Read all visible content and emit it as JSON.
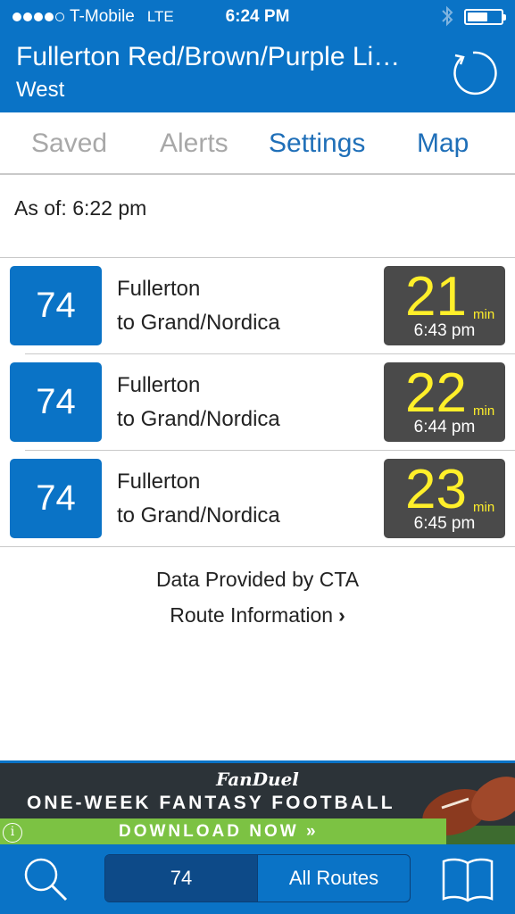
{
  "status_bar": {
    "carrier": "T-Mobile",
    "network": "LTE",
    "time": "6:24 PM"
  },
  "header": {
    "title": "Fullerton Red/Brown/Purple Li…",
    "subtitle": "West"
  },
  "tabs": [
    {
      "label": "Saved",
      "active": false
    },
    {
      "label": "Alerts",
      "active": false
    },
    {
      "label": "Settings",
      "active": true
    },
    {
      "label": "Map",
      "active": true
    }
  ],
  "as_of": "As of: 6:22 pm",
  "predictions": [
    {
      "route": "74",
      "stop": "Fullerton",
      "destination": "to Grand/Nordica",
      "minutes": "21",
      "unit": "min",
      "arrival": "6:43 pm"
    },
    {
      "route": "74",
      "stop": "Fullerton",
      "destination": "to Grand/Nordica",
      "minutes": "22",
      "unit": "min",
      "arrival": "6:44 pm"
    },
    {
      "route": "74",
      "stop": "Fullerton",
      "destination": "to Grand/Nordica",
      "minutes": "23",
      "unit": "min",
      "arrival": "6:45 pm"
    }
  ],
  "footer": {
    "credit": "Data Provided by CTA",
    "route_info": "Route Information"
  },
  "ad": {
    "brand": "FanDuel",
    "headline": "ONE-WEEK FANTASY FOOTBALL",
    "cta": "DOWNLOAD NOW »",
    "info": "i"
  },
  "bottom_bar": {
    "route_filter": "74",
    "all_routes": "All Routes"
  },
  "colors": {
    "brand_blue": "#0a73c6",
    "eta_yellow": "#ffef2a",
    "eta_bg": "#4a4a4a"
  }
}
